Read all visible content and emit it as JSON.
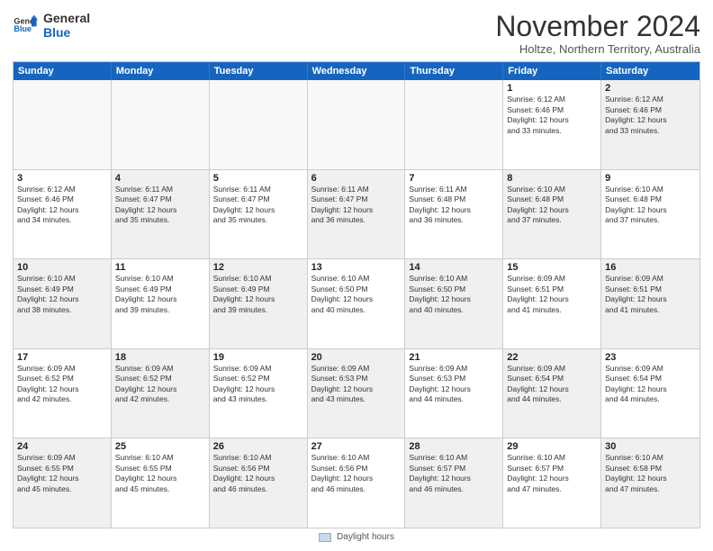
{
  "logo": {
    "line1": "General",
    "line2": "Blue"
  },
  "title": "November 2024",
  "subtitle": "Holtze, Northern Territory, Australia",
  "days_of_week": [
    "Sunday",
    "Monday",
    "Tuesday",
    "Wednesday",
    "Thursday",
    "Friday",
    "Saturday"
  ],
  "weeks": [
    [
      {
        "day": "",
        "info": "",
        "empty": true
      },
      {
        "day": "",
        "info": "",
        "empty": true
      },
      {
        "day": "",
        "info": "",
        "empty": true
      },
      {
        "day": "",
        "info": "",
        "empty": true
      },
      {
        "day": "",
        "info": "",
        "empty": true
      },
      {
        "day": "1",
        "info": "Sunrise: 6:12 AM\nSunset: 6:46 PM\nDaylight: 12 hours\nand 33 minutes."
      },
      {
        "day": "2",
        "info": "Sunrise: 6:12 AM\nSunset: 6:46 PM\nDaylight: 12 hours\nand 33 minutes.",
        "shaded": true
      }
    ],
    [
      {
        "day": "3",
        "info": "Sunrise: 6:12 AM\nSunset: 6:46 PM\nDaylight: 12 hours\nand 34 minutes."
      },
      {
        "day": "4",
        "info": "Sunrise: 6:11 AM\nSunset: 6:47 PM\nDaylight: 12 hours\nand 35 minutes.",
        "shaded": true
      },
      {
        "day": "5",
        "info": "Sunrise: 6:11 AM\nSunset: 6:47 PM\nDaylight: 12 hours\nand 35 minutes."
      },
      {
        "day": "6",
        "info": "Sunrise: 6:11 AM\nSunset: 6:47 PM\nDaylight: 12 hours\nand 36 minutes.",
        "shaded": true
      },
      {
        "day": "7",
        "info": "Sunrise: 6:11 AM\nSunset: 6:48 PM\nDaylight: 12 hours\nand 36 minutes."
      },
      {
        "day": "8",
        "info": "Sunrise: 6:10 AM\nSunset: 6:48 PM\nDaylight: 12 hours\nand 37 minutes.",
        "shaded": true
      },
      {
        "day": "9",
        "info": "Sunrise: 6:10 AM\nSunset: 6:48 PM\nDaylight: 12 hours\nand 37 minutes."
      }
    ],
    [
      {
        "day": "10",
        "info": "Sunrise: 6:10 AM\nSunset: 6:49 PM\nDaylight: 12 hours\nand 38 minutes.",
        "shaded": true
      },
      {
        "day": "11",
        "info": "Sunrise: 6:10 AM\nSunset: 6:49 PM\nDaylight: 12 hours\nand 39 minutes."
      },
      {
        "day": "12",
        "info": "Sunrise: 6:10 AM\nSunset: 6:49 PM\nDaylight: 12 hours\nand 39 minutes.",
        "shaded": true
      },
      {
        "day": "13",
        "info": "Sunrise: 6:10 AM\nSunset: 6:50 PM\nDaylight: 12 hours\nand 40 minutes."
      },
      {
        "day": "14",
        "info": "Sunrise: 6:10 AM\nSunset: 6:50 PM\nDaylight: 12 hours\nand 40 minutes.",
        "shaded": true
      },
      {
        "day": "15",
        "info": "Sunrise: 6:09 AM\nSunset: 6:51 PM\nDaylight: 12 hours\nand 41 minutes."
      },
      {
        "day": "16",
        "info": "Sunrise: 6:09 AM\nSunset: 6:51 PM\nDaylight: 12 hours\nand 41 minutes.",
        "shaded": true
      }
    ],
    [
      {
        "day": "17",
        "info": "Sunrise: 6:09 AM\nSunset: 6:52 PM\nDaylight: 12 hours\nand 42 minutes."
      },
      {
        "day": "18",
        "info": "Sunrise: 6:09 AM\nSunset: 6:52 PM\nDaylight: 12 hours\nand 42 minutes.",
        "shaded": true
      },
      {
        "day": "19",
        "info": "Sunrise: 6:09 AM\nSunset: 6:52 PM\nDaylight: 12 hours\nand 43 minutes."
      },
      {
        "day": "20",
        "info": "Sunrise: 6:09 AM\nSunset: 6:53 PM\nDaylight: 12 hours\nand 43 minutes.",
        "shaded": true
      },
      {
        "day": "21",
        "info": "Sunrise: 6:09 AM\nSunset: 6:53 PM\nDaylight: 12 hours\nand 44 minutes."
      },
      {
        "day": "22",
        "info": "Sunrise: 6:09 AM\nSunset: 6:54 PM\nDaylight: 12 hours\nand 44 minutes.",
        "shaded": true
      },
      {
        "day": "23",
        "info": "Sunrise: 6:09 AM\nSunset: 6:54 PM\nDaylight: 12 hours\nand 44 minutes."
      }
    ],
    [
      {
        "day": "24",
        "info": "Sunrise: 6:09 AM\nSunset: 6:55 PM\nDaylight: 12 hours\nand 45 minutes.",
        "shaded": true
      },
      {
        "day": "25",
        "info": "Sunrise: 6:10 AM\nSunset: 6:55 PM\nDaylight: 12 hours\nand 45 minutes."
      },
      {
        "day": "26",
        "info": "Sunrise: 6:10 AM\nSunset: 6:56 PM\nDaylight: 12 hours\nand 46 minutes.",
        "shaded": true
      },
      {
        "day": "27",
        "info": "Sunrise: 6:10 AM\nSunset: 6:56 PM\nDaylight: 12 hours\nand 46 minutes."
      },
      {
        "day": "28",
        "info": "Sunrise: 6:10 AM\nSunset: 6:57 PM\nDaylight: 12 hours\nand 46 minutes.",
        "shaded": true
      },
      {
        "day": "29",
        "info": "Sunrise: 6:10 AM\nSunset: 6:57 PM\nDaylight: 12 hours\nand 47 minutes."
      },
      {
        "day": "30",
        "info": "Sunrise: 6:10 AM\nSunset: 6:58 PM\nDaylight: 12 hours\nand 47 minutes.",
        "shaded": true
      }
    ]
  ],
  "legend": {
    "box_label": "Daylight hours"
  }
}
